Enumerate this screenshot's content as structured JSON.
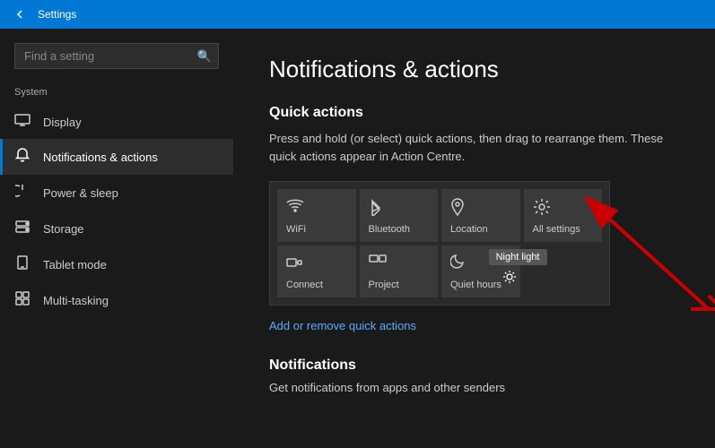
{
  "titlebar": {
    "title": "Settings",
    "back_label": "←"
  },
  "sidebar": {
    "search_placeholder": "Find a setting",
    "section_label": "System",
    "items": [
      {
        "id": "display",
        "label": "Display",
        "icon": "🖥"
      },
      {
        "id": "notifications",
        "label": "Notifications & actions",
        "icon": "🔔",
        "active": true
      },
      {
        "id": "power",
        "label": "Power & sleep",
        "icon": "⏻"
      },
      {
        "id": "storage",
        "label": "Storage",
        "icon": "💾"
      },
      {
        "id": "tablet",
        "label": "Tablet mode",
        "icon": "⌨"
      },
      {
        "id": "multitasking",
        "label": "Multi-tasking",
        "icon": "⧉"
      }
    ]
  },
  "content": {
    "title": "Notifications & actions",
    "quick_actions": {
      "heading": "Quick actions",
      "description": "Press and hold (or select) quick actions, then drag to rearrange them. These quick actions appear in Action Centre.",
      "tiles": [
        {
          "id": "wifi",
          "icon": "wifi",
          "label": "WiFi"
        },
        {
          "id": "bluetooth",
          "icon": "bluetooth",
          "label": "Bluetooth"
        },
        {
          "id": "location",
          "icon": "location",
          "label": "Location"
        },
        {
          "id": "all-settings",
          "icon": "settings",
          "label": "All settings"
        },
        {
          "id": "connect",
          "icon": "connect",
          "label": "Connect"
        },
        {
          "id": "project",
          "icon": "project",
          "label": "Project"
        },
        {
          "id": "quiet-hours",
          "icon": "moon",
          "label": "Quiet hours"
        }
      ],
      "tooltip": "Night light",
      "add_link": "Add or remove quick actions"
    },
    "notifications": {
      "heading": "Notifications",
      "description": "Get notifications from apps and other senders"
    }
  }
}
